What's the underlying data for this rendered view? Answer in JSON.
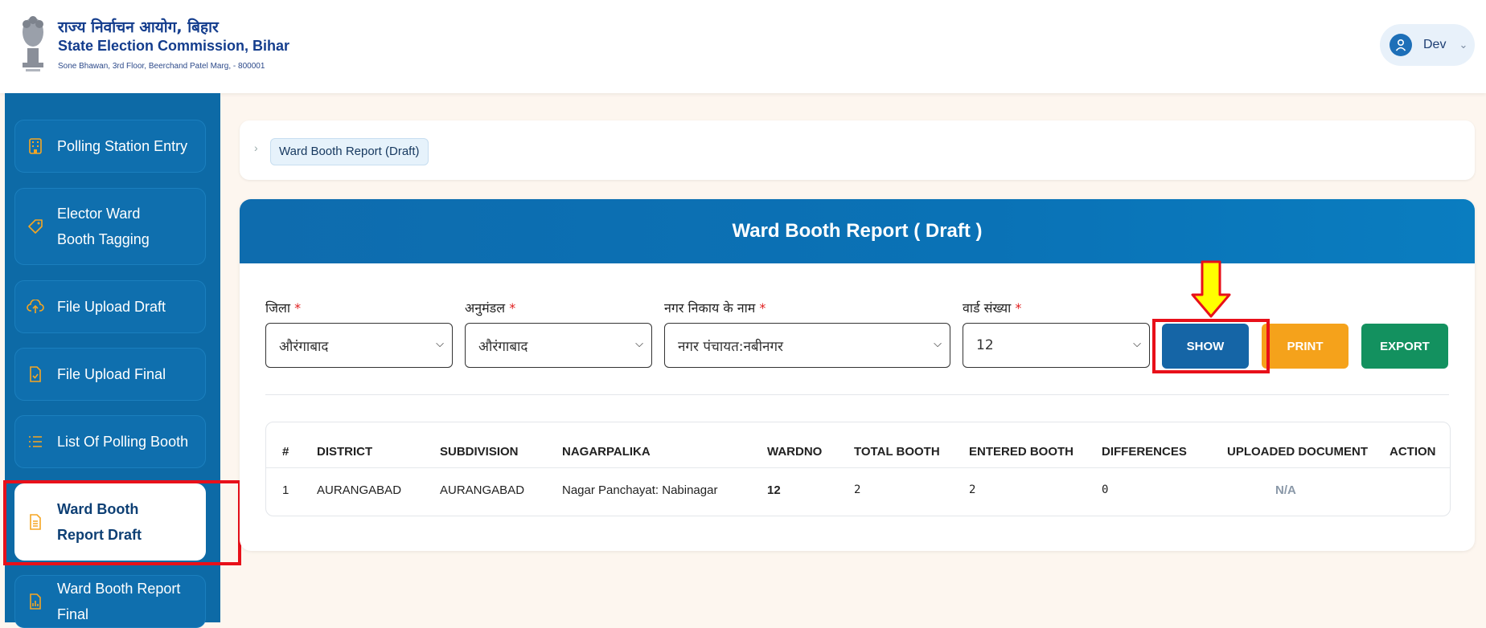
{
  "header": {
    "org_hindi": "राज्य निर्वाचन आयोग, बिहार",
    "org_english": "State Election Commission, Bihar",
    "address": "Sone Bhawan, 3rd Floor, Beerchand Patel Marg, - 800001",
    "user_name": "Dev"
  },
  "sidebar": {
    "items": [
      {
        "label": "Polling Station Entry"
      },
      {
        "label": "Elector Ward Booth Tagging"
      },
      {
        "label": "File Upload Draft"
      },
      {
        "label": "File Upload Final"
      },
      {
        "label": "List Of Polling Booth"
      },
      {
        "label": "Ward Booth Report Draft"
      },
      {
        "label": "Ward Booth Report Final"
      }
    ]
  },
  "breadcrumb": {
    "current": "Ward Booth Report (Draft)"
  },
  "card": {
    "title": "Ward Booth Report ( Draft )"
  },
  "filters": {
    "district": {
      "label": "जिला",
      "required": "*",
      "value": "औरंगाबाद"
    },
    "subdivision": {
      "label": "अनुमंडल",
      "required": "*",
      "value": "औरंगाबाद"
    },
    "nagar": {
      "label": "नगर निकाय के नाम",
      "required": "*",
      "value": "नगर पंचायत:नबीनगर"
    },
    "ward": {
      "label": "वार्ड संख्या",
      "required": "*",
      "value": "12"
    }
  },
  "buttons": {
    "show": "SHOW",
    "print": "PRINT",
    "export": "EXPORT"
  },
  "table": {
    "headers": [
      "#",
      "DISTRICT",
      "SUBDIVISION",
      "NAGARPALIKA",
      "WARDNO",
      "TOTAL BOOTH",
      "ENTERED BOOTH",
      "DIFFERENCES",
      "UPLOADED DOCUMENT",
      "ACTION"
    ],
    "rows": [
      [
        "1",
        "AURANGABAD",
        "AURANGABAD",
        "Nagar Panchayat: Nabinagar",
        "12",
        "2",
        "2",
        "0",
        "N/A",
        ""
      ]
    ]
  },
  "colors": {
    "sidebar": "#0d6aa6",
    "show": "#1565a6",
    "print": "#f5a21b",
    "export": "#13915f",
    "annotation_red": "#e8101a",
    "annotation_yellow": "#ffff00"
  }
}
